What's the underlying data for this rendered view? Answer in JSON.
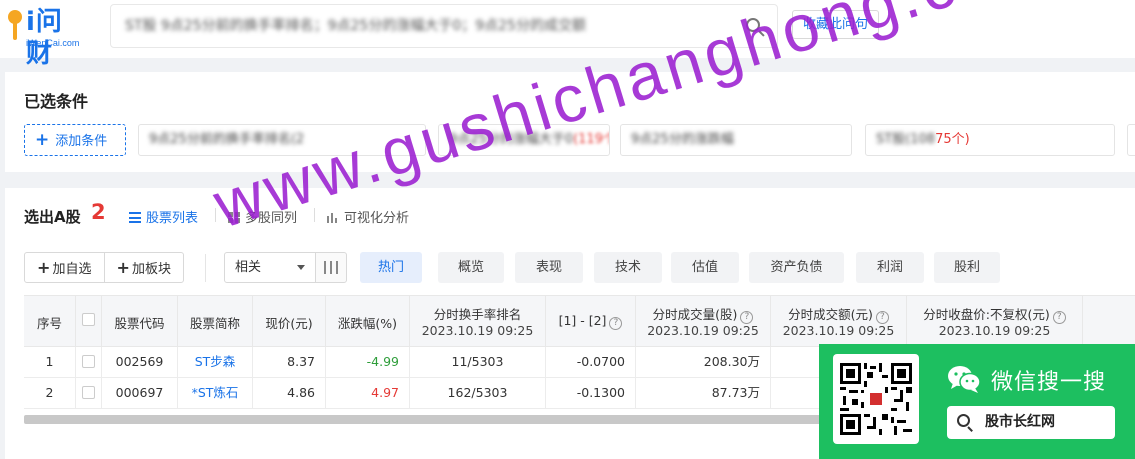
{
  "header": {
    "logo_text": "i问财",
    "logo_domain": "iWenCai.com",
    "query": "ST股 9点25分前的换手率排名；9点25分的涨幅大于0；9点25分的成交额",
    "save_button": "收藏此问句"
  },
  "conditions": {
    "title": "已选条件",
    "add_button": "添加条件",
    "chips": [
      {
        "text": "9点25分前的换手率排名(2",
        "count": ""
      },
      {
        "text": "9点25分的涨幅大于0",
        "count": "(119个)"
      },
      {
        "text": "9点25分的涨跌幅",
        "count": ""
      },
      {
        "text": "ST股(108",
        "count": "75个)"
      }
    ]
  },
  "results": {
    "title": "选出A股",
    "count": "2",
    "view_tabs": [
      "股票列表",
      "多股同列",
      "可视化分析"
    ],
    "actions": {
      "add_watch": "加自选",
      "add_sector": "加板块"
    },
    "sort_select": "相关",
    "category_tabs": [
      "热门",
      "概览",
      "表现",
      "技术",
      "估值",
      "资产负债",
      "利润",
      "股利"
    ],
    "columns": [
      {
        "line1": "序号",
        "line2": ""
      },
      {
        "line1": "",
        "line2": ""
      },
      {
        "line1": "股票代码",
        "line2": ""
      },
      {
        "line1": "股票简称",
        "line2": ""
      },
      {
        "line1": "现价(元)",
        "line2": ""
      },
      {
        "line1": "涨跌幅(%)",
        "line2": ""
      },
      {
        "line1": "分时换手率排名",
        "line2": "2023.10.19 09:25"
      },
      {
        "line1": "[1] - [2]",
        "line2": ""
      },
      {
        "line1": "分时成交量(股)",
        "line2": "2023.10.19 09:25"
      },
      {
        "line1": "分时成交额(元)",
        "line2": "2023.10.19 09:25"
      },
      {
        "line1": "分时收盘价:不复权(元)",
        "line2": "2023.10.19 09:25"
      }
    ],
    "rows": [
      {
        "index": "1",
        "code": "002569",
        "name": "ST步森",
        "price": "8.37",
        "change": "-4.99",
        "rank": "11/5303",
        "diff": "-0.0700",
        "volume": "208.30万"
      },
      {
        "index": "2",
        "code": "000697",
        "name": "*ST炼石",
        "price": "4.86",
        "change": "4.97",
        "rank": "162/5303",
        "diff": "-0.1300",
        "volume": "87.73万"
      }
    ]
  },
  "promo": {
    "title": "微信搜一搜",
    "keyword": "股市长红网"
  },
  "watermark": "www.gushichanghong.com",
  "colors": {
    "accent": "#1a73e8",
    "up": "#e53935",
    "down": "#2e9d3a",
    "promo_green": "#1dbf60",
    "watermark": "#9b1fd1"
  }
}
